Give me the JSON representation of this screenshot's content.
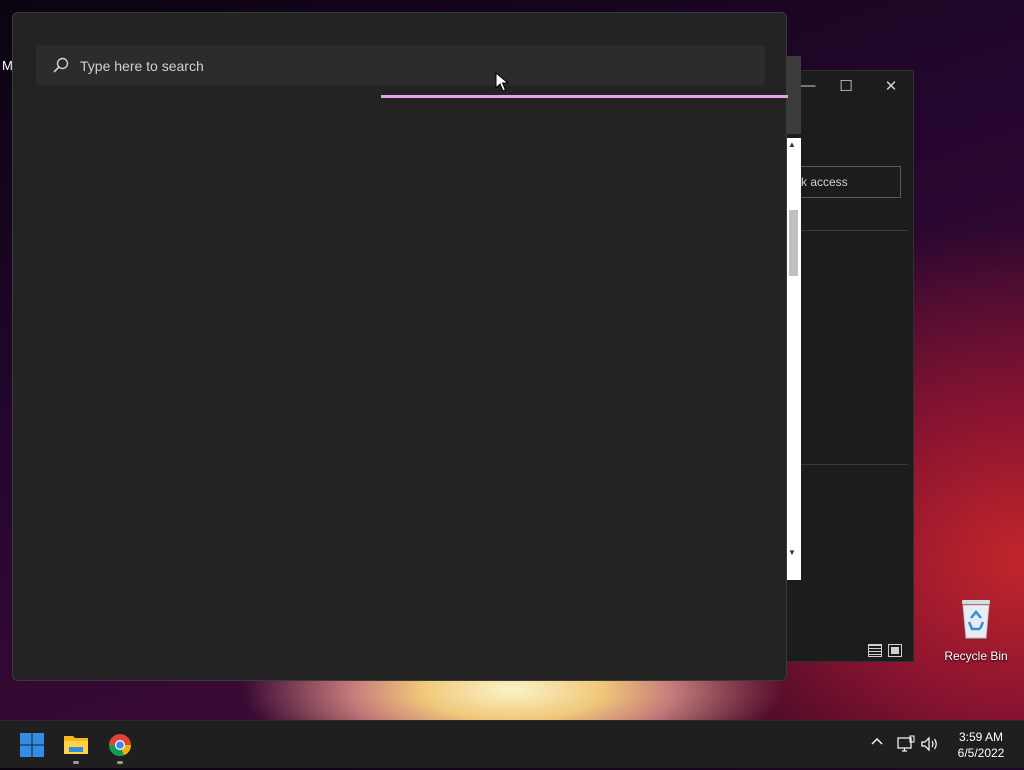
{
  "desktop": {
    "left_edge_text": "M",
    "recycle_bin_label": "Recycle Bin"
  },
  "explorer": {
    "minimize_glyph": "—",
    "maximize_glyph": "☐",
    "close_glyph": "✕",
    "address_text": "ck access",
    "view_icons": [
      "details-view-icon",
      "tiles-view-icon"
    ]
  },
  "search": {
    "placeholder": "Type here to search",
    "value": "",
    "accent_color": "#e6a2e6"
  },
  "taskbar": {
    "apps": [
      "start-icon",
      "file-explorer-icon",
      "chrome-icon"
    ],
    "tray_chevron": "^",
    "clock": {
      "time": "3:59 AM",
      "date": "6/5/2022"
    }
  },
  "colors": {
    "panel_bg": "#232323",
    "taskbar_bg": "#1f1f1f",
    "windows_blue": "#2f8fe5"
  }
}
